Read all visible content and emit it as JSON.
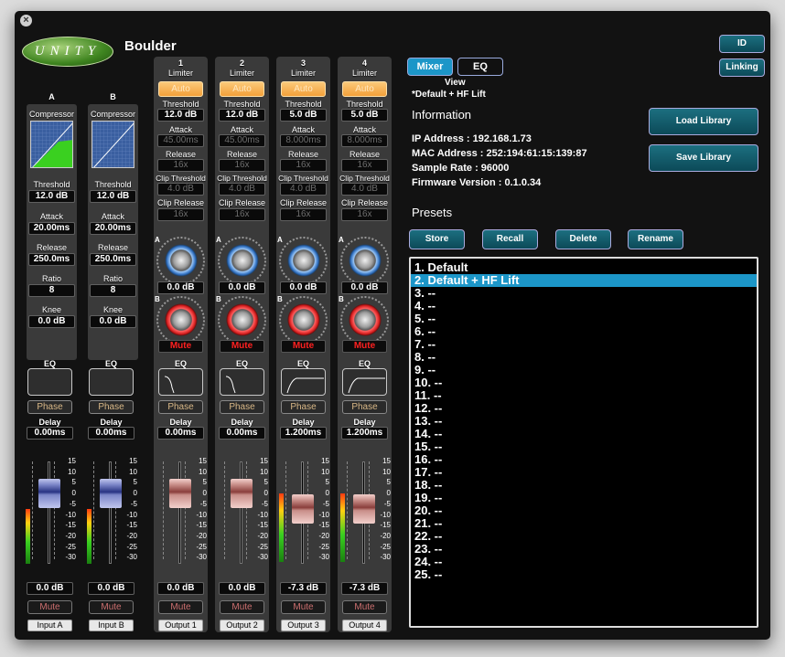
{
  "window": {
    "device_name": "Boulder",
    "logo_text": "UNITY"
  },
  "inputs": [
    {
      "id": "A",
      "section": "Compressor",
      "threshold_label": "Threshold",
      "threshold": "12.0 dB",
      "attack_label": "Attack",
      "attack": "20.00ms",
      "release_label": "Release",
      "release": "250.0ms",
      "ratio_label": "Ratio",
      "ratio": "8",
      "knee_label": "Knee",
      "knee": "0.0 dB",
      "eq_label": "EQ",
      "phase_label": "Phase",
      "delay_label": "Delay",
      "delay": "0.00ms",
      "gain": "0.0 dB",
      "mute_label": "Mute",
      "name": "Input A"
    },
    {
      "id": "B",
      "section": "Compressor",
      "threshold_label": "Threshold",
      "threshold": "12.0 dB",
      "attack_label": "Attack",
      "attack": "20.00ms",
      "release_label": "Release",
      "release": "250.0ms",
      "ratio_label": "Ratio",
      "ratio": "8",
      "knee_label": "Knee",
      "knee": "0.0 dB",
      "eq_label": "EQ",
      "phase_label": "Phase",
      "delay_label": "Delay",
      "delay": "0.00ms",
      "gain": "0.0 dB",
      "mute_label": "Mute",
      "name": "Input B"
    }
  ],
  "outputs": [
    {
      "id": "1",
      "limiter_label": "Limiter",
      "auto_label": "Auto",
      "threshold_label": "Threshold",
      "threshold": "12.0 dB",
      "attack_label": "Attack",
      "attack": "45.00ms",
      "release_label": "Release",
      "release": "16x",
      "clip_threshold_label": "Clip Threshold",
      "clip_threshold": "4.0 dB",
      "clip_release_label": "Clip Release",
      "clip_release": "16x",
      "knob_a_label": "A",
      "knob_b_label": "B",
      "mix": "0.0 dB",
      "mute_red": "Mute",
      "eq_label": "EQ",
      "phase_label": "Phase",
      "delay_label": "Delay",
      "delay": "0.00ms",
      "gain": "0.0 dB",
      "mute_label": "Mute",
      "name": "Output 1",
      "fader_db": 0
    },
    {
      "id": "2",
      "limiter_label": "Limiter",
      "auto_label": "Auto",
      "threshold_label": "Threshold",
      "threshold": "12.0 dB",
      "attack_label": "Attack",
      "attack": "45.00ms",
      "release_label": "Release",
      "release": "16x",
      "clip_threshold_label": "Clip Threshold",
      "clip_threshold": "4.0 dB",
      "clip_release_label": "Clip Release",
      "clip_release": "16x",
      "knob_a_label": "A",
      "knob_b_label": "B",
      "mix": "0.0 dB",
      "mute_red": "Mute",
      "eq_label": "EQ",
      "phase_label": "Phase",
      "delay_label": "Delay",
      "delay": "0.00ms",
      "gain": "0.0 dB",
      "mute_label": "Mute",
      "name": "Output 2",
      "fader_db": 0
    },
    {
      "id": "3",
      "limiter_label": "Limiter",
      "auto_label": "Auto",
      "threshold_label": "Threshold",
      "threshold": "5.0 dB",
      "attack_label": "Attack",
      "attack": "8.000ms",
      "release_label": "Release",
      "release": "16x",
      "clip_threshold_label": "Clip Threshold",
      "clip_threshold": "4.0 dB",
      "clip_release_label": "Clip Release",
      "clip_release": "16x",
      "knob_a_label": "A",
      "knob_b_label": "B",
      "mix": "0.0 dB",
      "mute_red": "Mute",
      "eq_label": "EQ",
      "phase_label": "Phase",
      "delay_label": "Delay",
      "delay": "1.200ms",
      "gain": "-7.3 dB",
      "mute_label": "Mute",
      "name": "Output 3",
      "fader_db": -7.3
    },
    {
      "id": "4",
      "limiter_label": "Limiter",
      "auto_label": "Auto",
      "threshold_label": "Threshold",
      "threshold": "5.0 dB",
      "attack_label": "Attack",
      "attack": "8.000ms",
      "release_label": "Release",
      "release": "16x",
      "clip_threshold_label": "Clip Threshold",
      "clip_threshold": "4.0 dB",
      "clip_release_label": "Clip Release",
      "clip_release": "16x",
      "knob_a_label": "A",
      "knob_b_label": "B",
      "mix": "0.0 dB",
      "mute_red": "Mute",
      "eq_label": "EQ",
      "phase_label": "Phase",
      "delay_label": "Delay",
      "delay": "1.200ms",
      "gain": "-7.3 dB",
      "mute_label": "Mute",
      "name": "Output 4",
      "fader_db": -7.3
    }
  ],
  "fader_scale": [
    "15",
    "10",
    "5",
    "0",
    "-5",
    "-10",
    "-15",
    "-20",
    "-25",
    "-30"
  ],
  "view": {
    "mixer_label": "Mixer",
    "eq_label": "EQ",
    "view_label": "View",
    "current_preset": "*Default + HF Lift"
  },
  "top_buttons": {
    "id_label": "ID",
    "linking_label": "Linking"
  },
  "information": {
    "title": "Information",
    "ip": "IP Address : 192.168.1.73",
    "mac": "MAC Address : 252:194:61:15:139:87",
    "sample_rate": "Sample Rate : 96000",
    "firmware": "Firmware Version : 0.1.0.34",
    "load_library": "Load Library",
    "save_library": "Save Library"
  },
  "presets": {
    "title": "Presets",
    "store": "Store",
    "recall": "Recall",
    "delete": "Delete",
    "rename": "Rename",
    "selected_index": 1,
    "items": [
      "1. Default",
      "2. Default + HF Lift",
      "3. --",
      "4. --",
      "5. --",
      "6. --",
      "7. --",
      "8. --",
      "9. --",
      "10. --",
      "11. --",
      "12. --",
      "13. --",
      "14. --",
      "15. --",
      "16. --",
      "17. --",
      "18. --",
      "19. --",
      "20. --",
      "21. --",
      "22. --",
      "23. --",
      "24. --",
      "25. --"
    ]
  },
  "colors": {
    "accent": "#1c96c8",
    "mute_red": "#ff2020",
    "auto_orange": "#f3a03a"
  }
}
